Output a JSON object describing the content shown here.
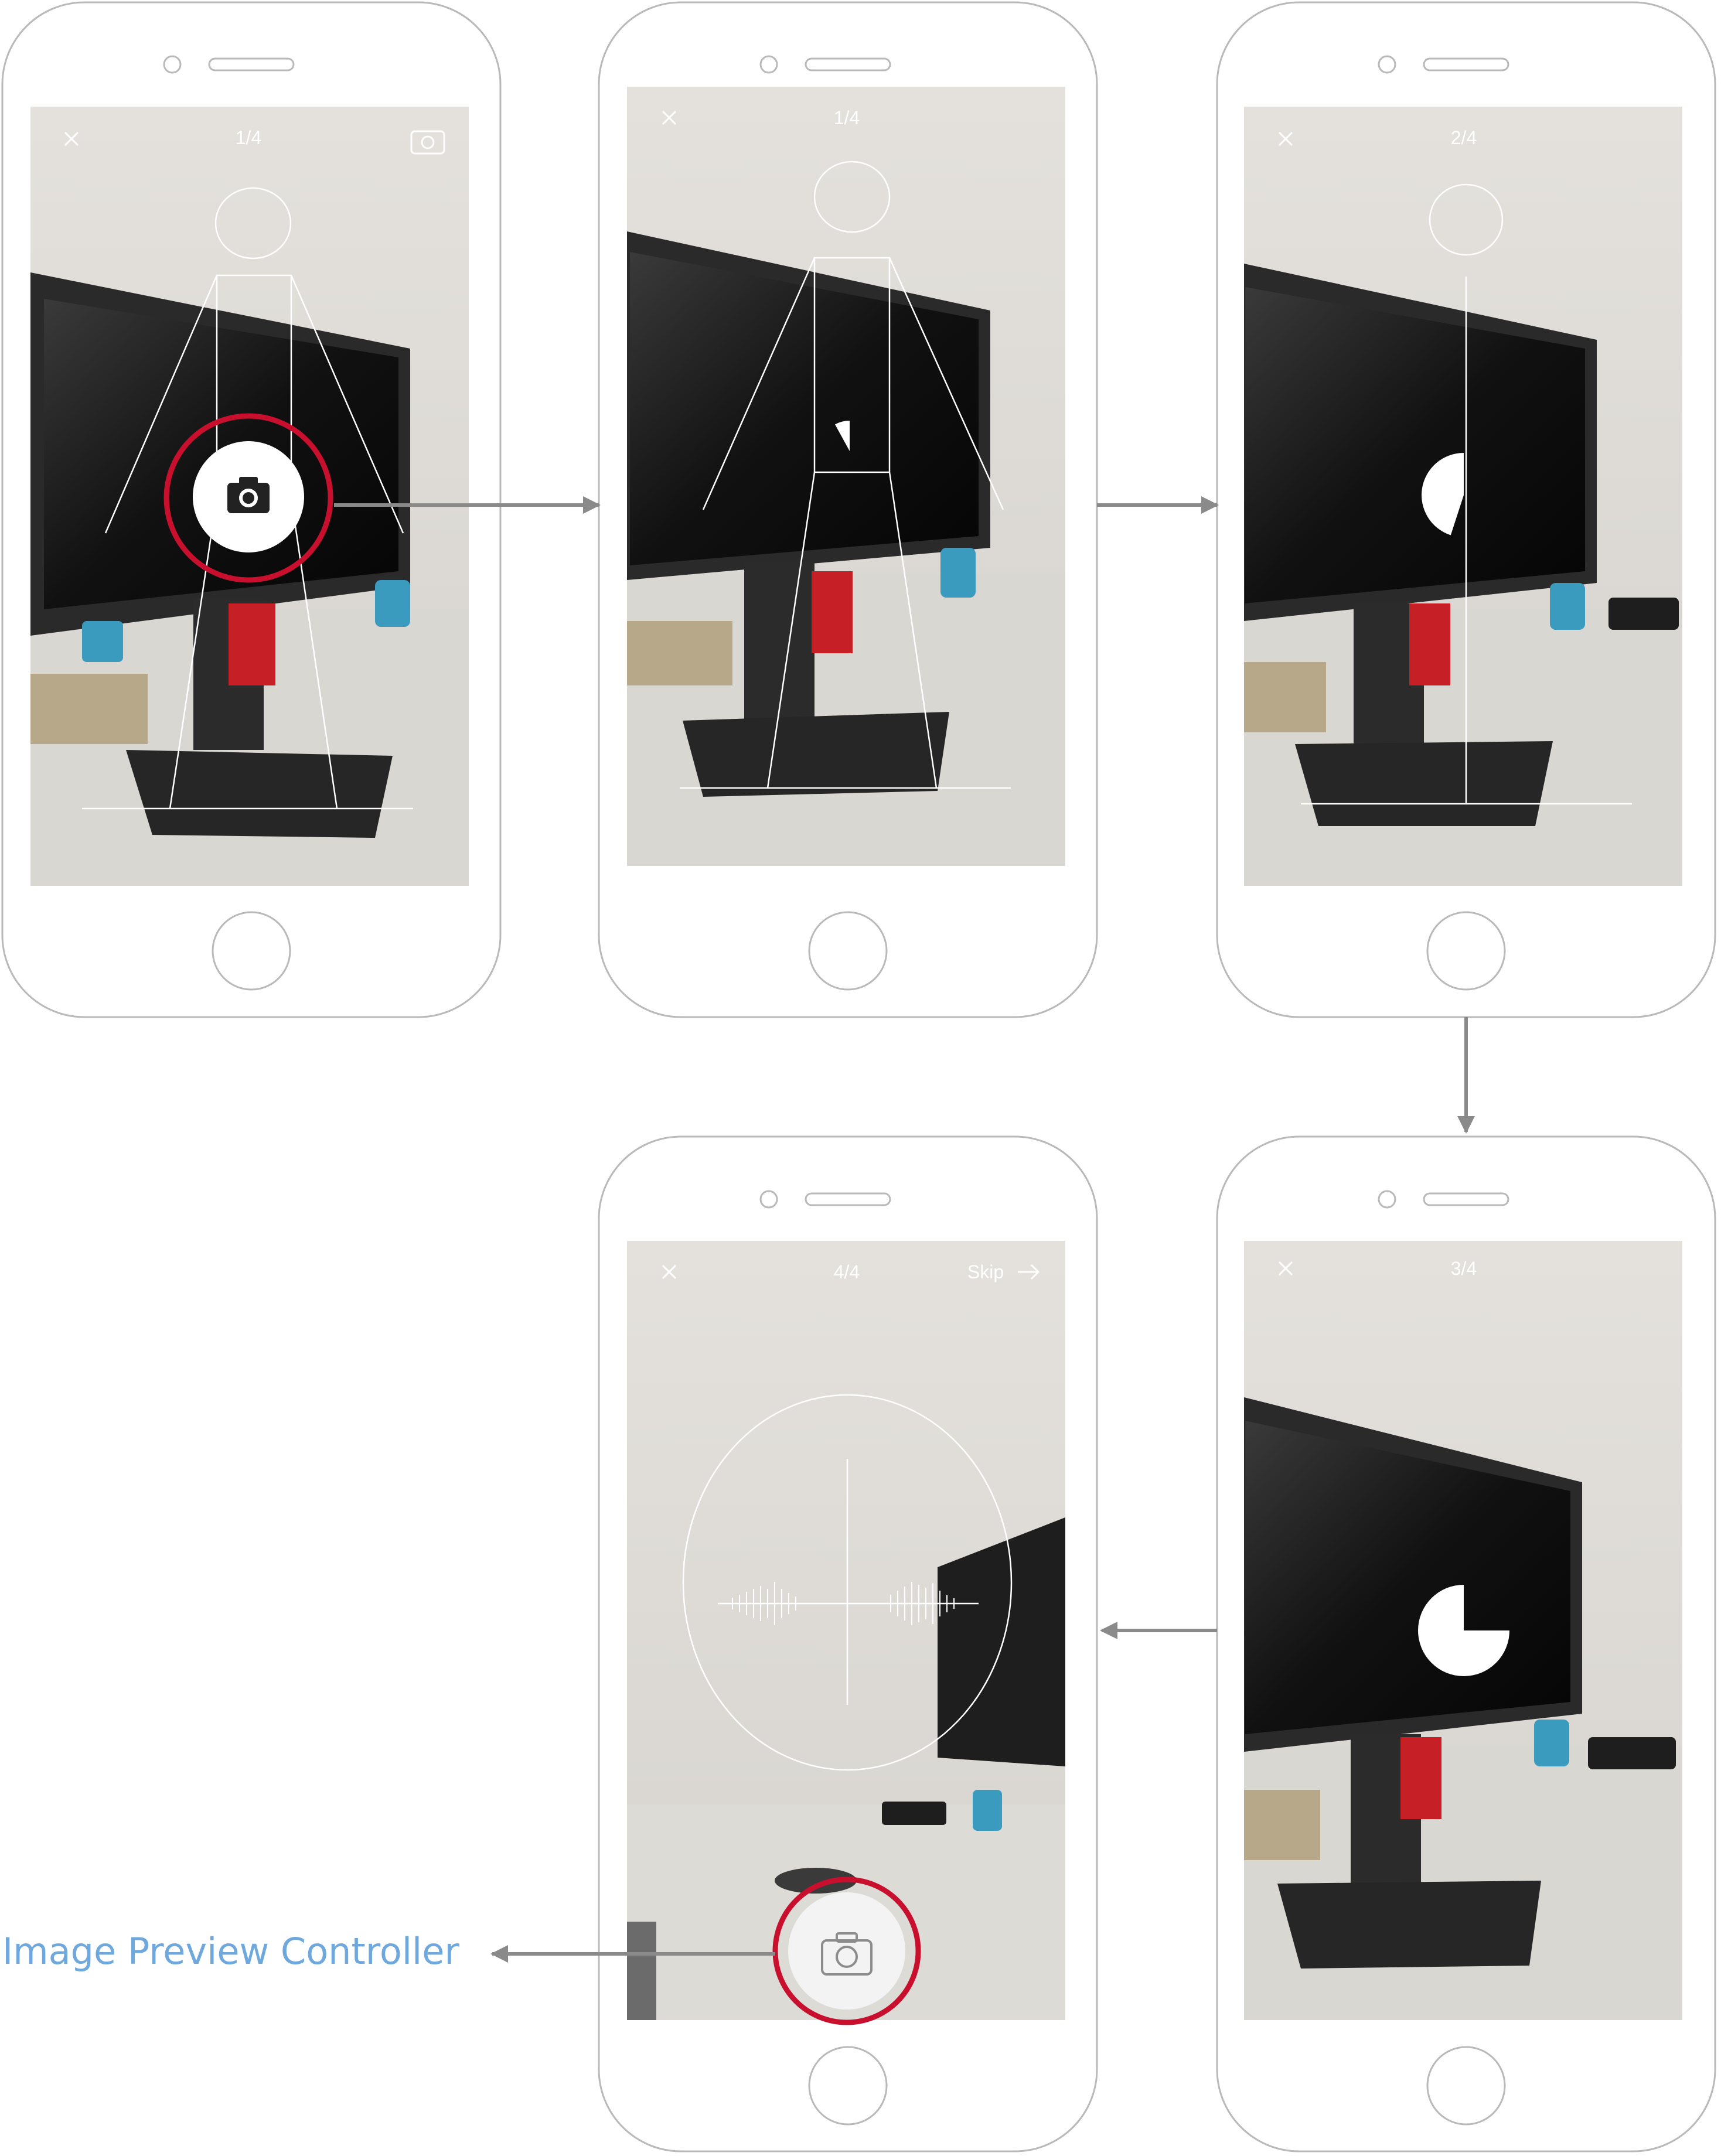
{
  "screens": [
    {
      "id": "s1",
      "counter": "1/4",
      "close_icon": "close-icon",
      "right_icon": "flip-camera-icon",
      "overlay": "body-outline",
      "capture_icon": "camera-icon",
      "highlighted": true
    },
    {
      "id": "s2",
      "counter": "1/4",
      "close_icon": "close-icon",
      "overlay": "body-outline",
      "progress": 0.08
    },
    {
      "id": "s3",
      "counter": "2/4",
      "close_icon": "close-icon",
      "overlay": "side-line",
      "progress": 0.45
    },
    {
      "id": "s4",
      "counter": "3/4",
      "close_icon": "close-icon",
      "overlay": "none",
      "progress": 0.75
    },
    {
      "id": "s5",
      "counter": "4/4",
      "close_icon": "close-icon",
      "skip_label": "Skip",
      "skip_icon": "arrow-right-icon",
      "overlay": "oval",
      "capture_icon": "camera-icon",
      "highlighted": true
    }
  ],
  "annotation": {
    "label": "Image Preview Controller"
  },
  "colors": {
    "highlight": "#c8102e",
    "annotation_text": "#6fa8dc",
    "arrow": "#8a8a8a",
    "phone_outline": "#b9b9b9"
  }
}
